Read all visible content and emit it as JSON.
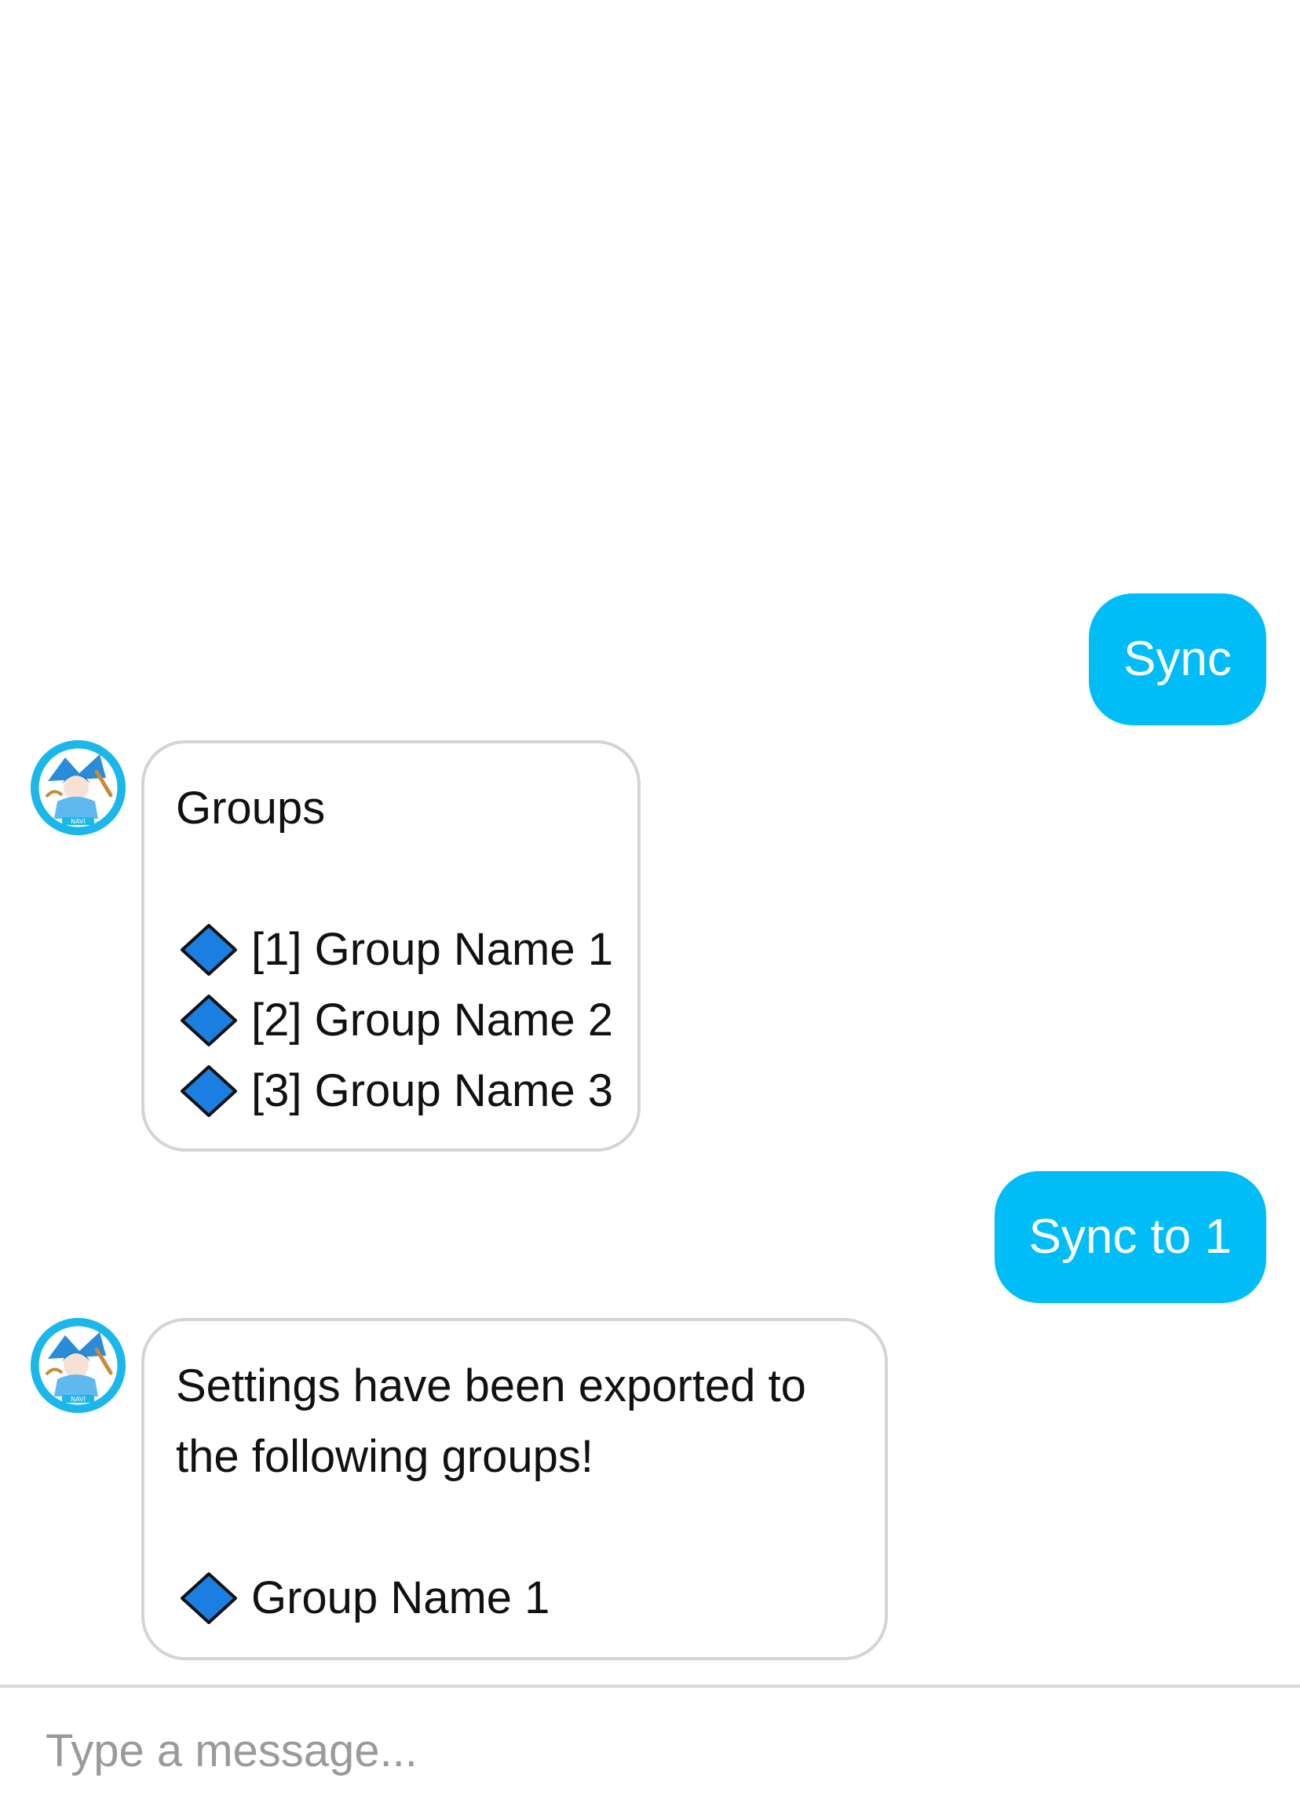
{
  "colors": {
    "accent": "#00BDF8",
    "bot_bubble_border": "#D4D4D4",
    "diamond_fill": "#1A7FE0",
    "placeholder": "#9A9A9A"
  },
  "messages": [
    {
      "sender": "user",
      "text": "Sync"
    },
    {
      "sender": "bot",
      "avatar_icon": "navi-avatar-icon",
      "avatar_text": "NAVI",
      "lines": [
        "Groups",
        ""
      ],
      "items": [
        {
          "bullet_icon": "blue-diamond-icon",
          "text": "[1] Group Name 1"
        },
        {
          "bullet_icon": "blue-diamond-icon",
          "text": "[2] Group Name 2"
        },
        {
          "bullet_icon": "blue-diamond-icon",
          "text": "[3] Group Name 3"
        }
      ]
    },
    {
      "sender": "user",
      "text": "Sync to 1"
    },
    {
      "sender": "bot",
      "avatar_icon": "navi-avatar-icon",
      "avatar_text": "NAVI",
      "lines": [
        "Settings have been exported to",
        "the following groups!",
        ""
      ],
      "items": [
        {
          "bullet_icon": "blue-diamond-icon",
          "text": "Group Name 1"
        }
      ]
    }
  ],
  "composer": {
    "placeholder": "Type a message...",
    "value": ""
  }
}
